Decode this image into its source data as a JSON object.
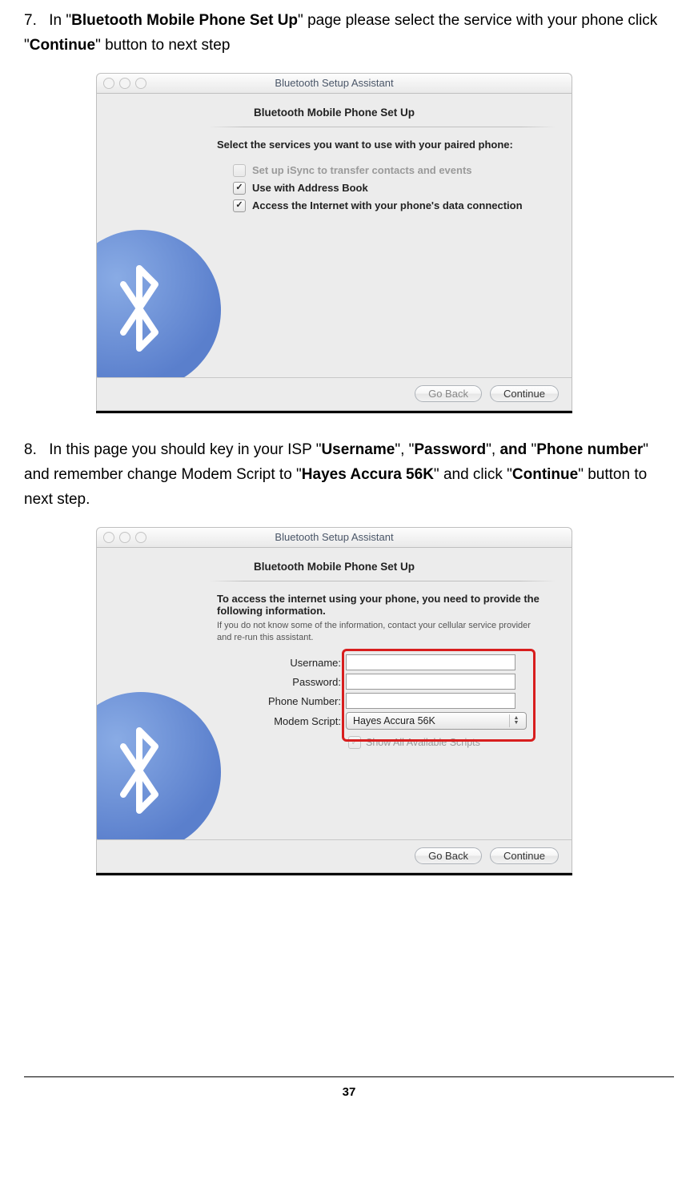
{
  "step7": {
    "num": "7.",
    "t1": "In \"",
    "b1": "Bluetooth Mobile Phone Set Up",
    "t2": "\" page please select the service with your phone click \"",
    "b2": "Continue",
    "t3": "\" button to next step"
  },
  "step8": {
    "num": "8.",
    "t1": "In this page you should key in your ISP \"",
    "b1": "Username",
    "t2": "\", \"",
    "b2": "Password",
    "t3": "\", ",
    "b3": "and",
    "t4": " \"",
    "b4": "Phone number",
    "t5": "\" and remember change Modem Script to \"",
    "b5": "Hayes Accura 56K",
    "t6": "\" and click \"",
    "b6": "Continue",
    "t7": "\" button to next step."
  },
  "shot1": {
    "title": "Bluetooth Setup Assistant",
    "section": "Bluetooth Mobile Phone Set Up",
    "prompt": "Select the services you want to use with your paired phone:",
    "opt1": {
      "label": "Set up iSync to transfer contacts and events",
      "checked": false,
      "enabled": false
    },
    "opt2": {
      "label": "Use with Address Book",
      "checked": true,
      "enabled": true
    },
    "opt3": {
      "label": "Access the Internet with your phone's data connection",
      "checked": true,
      "enabled": true
    },
    "back": "Go Back",
    "continue": "Continue"
  },
  "shot2": {
    "title": "Bluetooth Setup Assistant",
    "section": "Bluetooth Mobile Phone Set Up",
    "prompt": "To access the internet using your phone, you need to provide the following information.",
    "note": "If you do not know some of the information, contact your cellular service provider and re-run this assistant.",
    "fields": {
      "username": "Username:",
      "password": "Password:",
      "phone": "Phone Number:",
      "script": "Modem Script:"
    },
    "script_value": "Hayes Accura 56K",
    "show_all": "Show All Available Scripts",
    "back": "Go Back",
    "continue": "Continue"
  },
  "page_number": "37"
}
